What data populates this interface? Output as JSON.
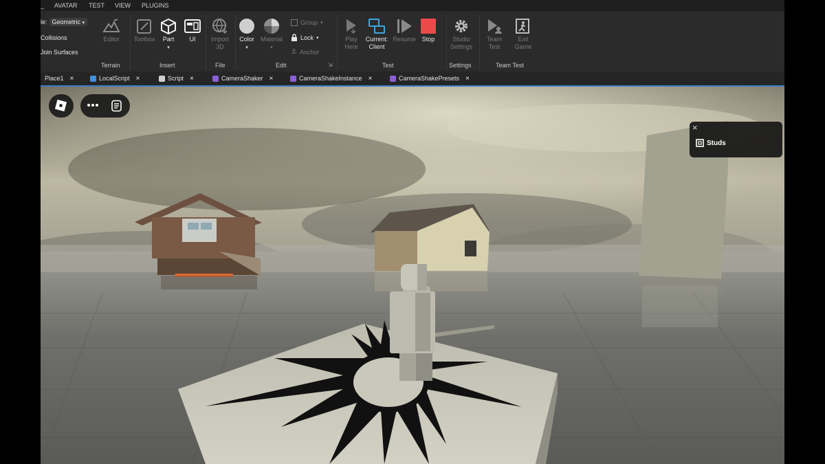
{
  "menu": {
    "left_fragment": "_",
    "items": [
      "AVATAR",
      "TEST",
      "VIEW",
      "PLUGINS"
    ]
  },
  "ribbon": {
    "terrain": {
      "mode_label_fragment": "le:",
      "mode_value": "Geometric",
      "collisions_label": "Collisions",
      "join_surfaces_label": "Join Surfaces",
      "editor_label": "Editor",
      "group_label": "Terrain"
    },
    "insert": {
      "toolbox_label": "Toolbox",
      "part_label": "Part",
      "ui_label": "UI",
      "group_label": "Insert"
    },
    "file": {
      "import_label_1": "Import",
      "import_label_2": "3D",
      "group_label": "File"
    },
    "edit": {
      "color_label": "Color",
      "material_label": "Material",
      "group_label_text": "Group",
      "lock_label": "Lock",
      "anchor_label": "Anchor",
      "group_label": "Edit",
      "expand_glyph": "⇲"
    },
    "test": {
      "play_here_1": "Play",
      "play_here_2": "Here",
      "current_client_1": "Current:",
      "current_client_2": "Client",
      "resume_label": "Resume",
      "stop_label": "Stop",
      "group_label": "Test"
    },
    "settings": {
      "studio_settings_1": "Studio",
      "studio_settings_2": "Settings",
      "group_label": "Settings"
    },
    "team_test": {
      "team_test_1": "Team",
      "team_test_2": "Test",
      "exit_game_1": "Exit",
      "exit_game_2": "Game",
      "group_label": "Team Test"
    }
  },
  "tabs": [
    {
      "label": "Place1",
      "icon_color": ""
    },
    {
      "label": "LocalScript",
      "icon_color": "#3f8ee0"
    },
    {
      "label": "Script",
      "icon_color": "#cfcfcf"
    },
    {
      "label": "CameraShaker",
      "icon_color": "#8b5fd6"
    },
    {
      "label": "CameraShakeInstance",
      "icon_color": "#8b5fd6"
    },
    {
      "label": "CameraShakePresets",
      "icon_color": "#8b5fd6"
    }
  ],
  "tab_close_glyph": "×",
  "viewport": {
    "studs_popup_label": "Studs",
    "close_glyph": "×"
  },
  "colors": {
    "accent": "#3b79c6",
    "stop_button": "#ec4a4a",
    "module_script": "#8b5fd6",
    "local_script": "#3f8ee0"
  }
}
